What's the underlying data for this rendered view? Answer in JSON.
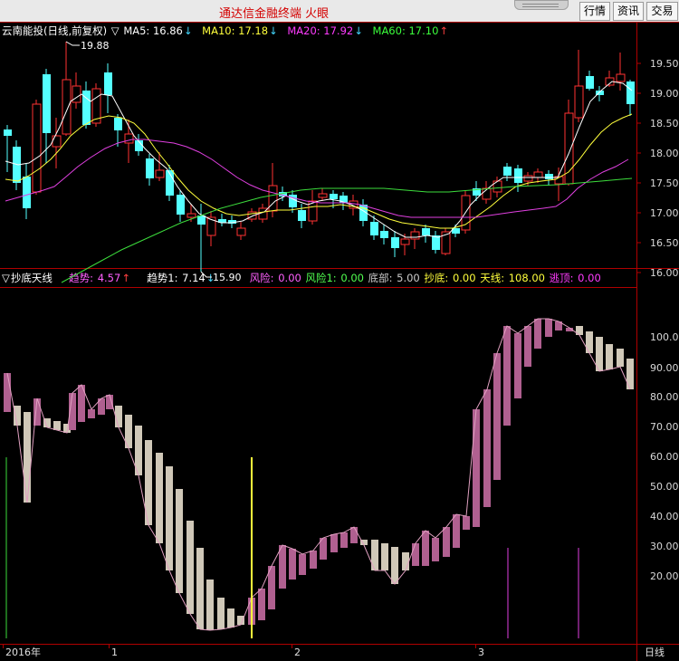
{
  "window": {
    "app_title": "通达信金融终端  火眼",
    "buttons": [
      {
        "label": "行情"
      },
      {
        "label": "资讯"
      },
      {
        "label": "交易"
      }
    ]
  },
  "main_panel": {
    "stock_name": "云南能投(日线,前复权)",
    "indicators": [
      {
        "label": "MA5: 16.86",
        "arrow": "↓",
        "color": "#ffffff"
      },
      {
        "label": "MA10: 17.18",
        "arrow": "↓",
        "color": "#ffff3c"
      },
      {
        "label": "MA20: 17.92",
        "arrow": "↓",
        "color": "#ff3cff"
      },
      {
        "label": "MA60: 17.10",
        "arrow": "↑",
        "color": "#3cff3c"
      }
    ],
    "yaxis": [
      "19.50",
      "19.00",
      "18.50",
      "18.00",
      "17.50",
      "17.00",
      "16.50",
      "16.00"
    ],
    "high_mark": "19.88",
    "low_mark": "15.90"
  },
  "sub_panel": {
    "name": "抄底天线",
    "trend": {
      "label": "趋势:",
      "value": "4.57",
      "arrow": "↑"
    },
    "trend1": {
      "label": "趋势1:",
      "value": "7.14",
      "arrow": "↓"
    },
    "risk": {
      "label": "风险:",
      "value": "0.00"
    },
    "risk1": {
      "label": "风险1:",
      "value": "0.00"
    },
    "bottom": {
      "label": "底部:",
      "value": "5.00"
    },
    "buy_bottom": {
      "label": "抄底:",
      "value": "0.00"
    },
    "antenna": {
      "label": "天线:",
      "value": "108.00"
    },
    "escape": {
      "label": "逃顶:",
      "value": "0.00"
    },
    "yaxis": [
      "100.00",
      "90.00",
      "80.00",
      "70.00",
      "60.00",
      "50.00",
      "40.00",
      "30.00",
      "20.00"
    ]
  },
  "bottom_axis": {
    "labels": [
      "2016年",
      "1",
      "2",
      "3"
    ],
    "period": "日线"
  },
  "colors": {
    "up": "#ff3232",
    "down": "#54ffff",
    "ma5": "#ffffff",
    "ma10": "#ffff3c",
    "ma20": "#e040e0",
    "ma60": "#3cdc3c",
    "pink_bar": "#b06090",
    "beige_bar": "#d0c8b8",
    "frame": "#b00000"
  }
}
